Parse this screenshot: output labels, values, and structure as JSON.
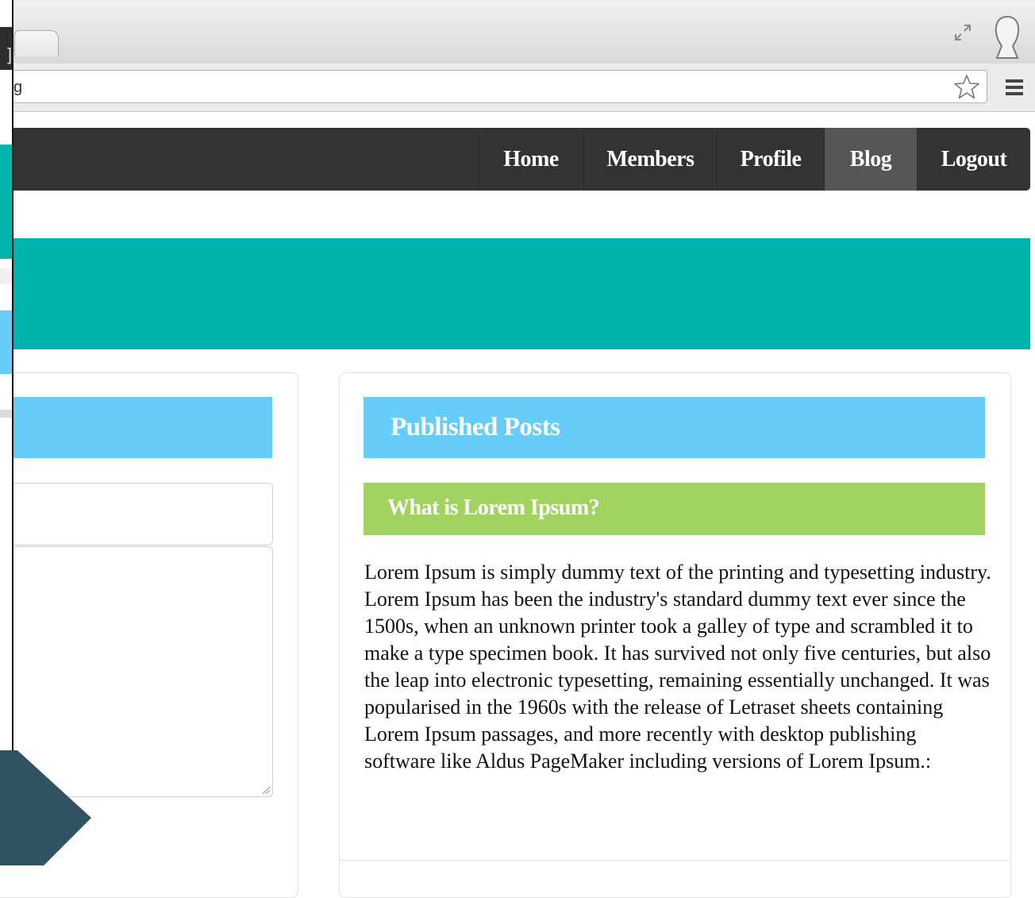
{
  "browser": {
    "address_fragment": "g",
    "strip_fragment": "]",
    "icons": {
      "fullscreen": "fullscreen-arrows-icon",
      "profile": "user-profile-icon",
      "bookmark": "star-icon",
      "menu": "hamburger-menu-icon"
    }
  },
  "navbar": {
    "links": [
      {
        "label": "Home"
      },
      {
        "label": "Members"
      },
      {
        "label": "Profile"
      },
      {
        "label": "Blog",
        "active": true
      },
      {
        "label": "Logout"
      }
    ]
  },
  "published_posts": {
    "heading": "Published Posts",
    "posts": [
      {
        "title": "What is Lorem Ipsum?",
        "body": "Lorem Ipsum is simply dummy text of the printing and typesetting industry. Lorem Ipsum has been the industry's standard dummy text ever since the 1500s, when an unknown printer took a galley of type and scrambled it to make a type specimen book. It has survived not only five centuries, but also the leap into electronic typesetting, remaining essentially unchanged. It was popularised in the 1960s with the release of Letraset sheets containing Lorem Ipsum passages, and more recently with desktop publishing software like Aldus PageMaker including versions of Lorem Ipsum.:"
      }
    ]
  },
  "colors": {
    "navbar": "#333333",
    "nav_active": "#555555",
    "banner": "#00b4ae",
    "panel_header": "#67cdf8",
    "post_title": "#a2d361",
    "corner_shape": "#2f5361"
  }
}
